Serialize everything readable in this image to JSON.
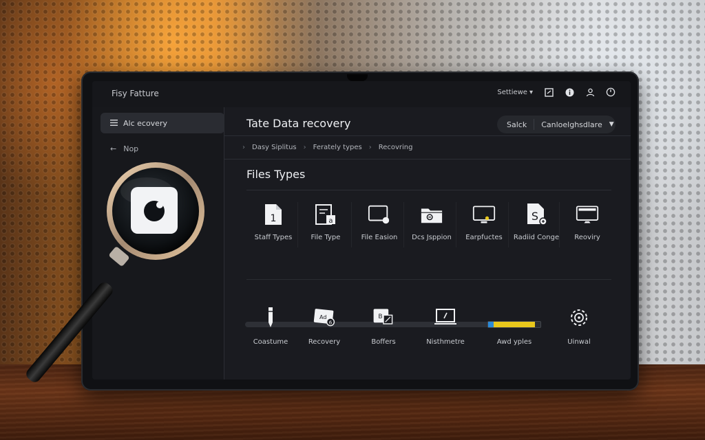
{
  "app": {
    "title": "Fisy Fatture"
  },
  "topbar": {
    "profile_label": "Settiewe",
    "icons": [
      "screen-icon",
      "info-icon",
      "user-icon",
      "power-icon"
    ]
  },
  "sidebar": {
    "items": [
      {
        "label": "Alc ecovery",
        "icon": "menu-icon",
        "active": true
      },
      {
        "label": "Nop",
        "icon": "back-arrow-icon",
        "active": false
      }
    ]
  },
  "header": {
    "title": "Tate Data recovery",
    "search_label": "Salck",
    "dropdown_value": "Canloelghsdlare"
  },
  "breadcrumb": [
    "Dasy Siplitus",
    "Ferately types",
    "Recovring"
  ],
  "section": {
    "title": "Files Types"
  },
  "file_types": [
    {
      "label": "Staff Types",
      "icon": "document-number-icon"
    },
    {
      "label": "File Type",
      "icon": "file-edit-icon"
    },
    {
      "label": "File Easion",
      "icon": "monitor-badge-icon"
    },
    {
      "label": "Dcs Jsppion",
      "icon": "folder-icon"
    },
    {
      "label": "Earpfuctes",
      "icon": "display-icon"
    },
    {
      "label": "Radiid Conge",
      "icon": "dollar-document-icon"
    },
    {
      "label": "Reoviry",
      "icon": "desktop-icon"
    }
  ],
  "tools": [
    {
      "label": "Coastume",
      "icon": "pen-icon"
    },
    {
      "label": "Recovery",
      "icon": "card-icon"
    },
    {
      "label": "Boffers",
      "icon": "buffer-icon"
    },
    {
      "label": "Nisthmetre",
      "icon": "laptop-icon"
    },
    {
      "label": "Awd yples",
      "icon": "progress-icon"
    },
    {
      "label": "Uinwal",
      "icon": "gear-icon"
    }
  ],
  "progress": {
    "fraction": 0.9
  },
  "colors": {
    "screen_bg": "#1a1b20",
    "accent_yellow": "#e8c71c",
    "accent_blue": "#2b8ad8"
  }
}
